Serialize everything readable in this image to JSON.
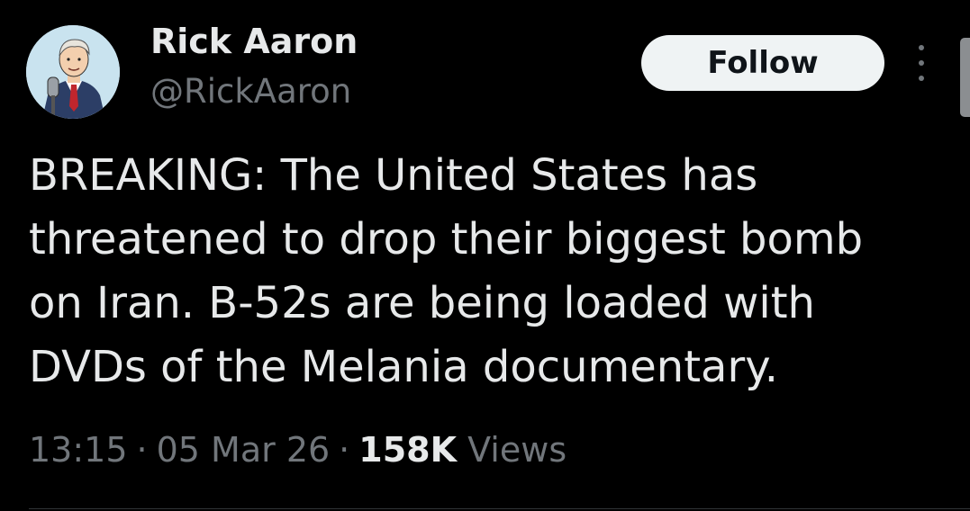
{
  "author": {
    "display_name": "Rick Aaron",
    "handle": "@RickAaron",
    "avatar": "cartoon-man-microphone-avatar"
  },
  "actions": {
    "follow_label": "Follow",
    "more_icon": "more-vertical-icon"
  },
  "tweet": {
    "lines": [
      "BREAKING: The United States has",
      "threatened to drop their biggest bomb",
      "on Iran. B-52s are being loaded with",
      "DVDs of the Melania documentary."
    ]
  },
  "meta": {
    "time": "13:15",
    "date": "05 Mar 26",
    "separator": "·",
    "views_count": "158K",
    "views_label": "Views"
  },
  "colors": {
    "background": "#000000",
    "primary_text": "#e7e9ea",
    "secondary_text": "#71767b",
    "follow_bg": "#eff3f4"
  }
}
